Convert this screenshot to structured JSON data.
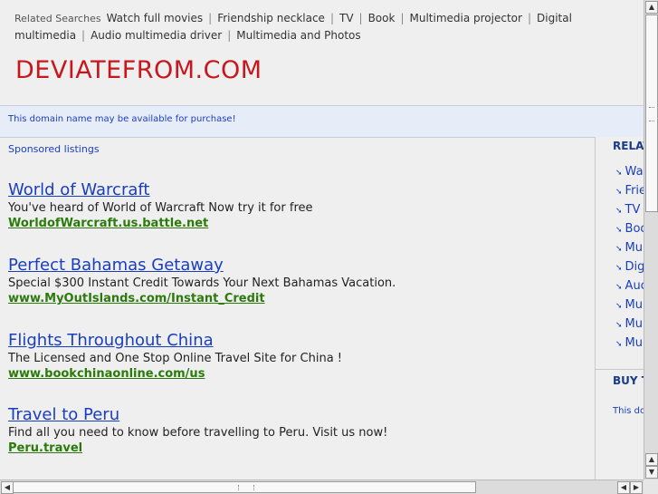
{
  "related_top": {
    "label": "Related Searches",
    "links": [
      "Watch full movies",
      "Friendship necklace",
      "TV",
      "Book",
      "Multimedia projector",
      "Digital multimedia",
      "Audio multimedia driver",
      "Multimedia and Photos"
    ]
  },
  "domain_title": "DEVIATEFROM.COM",
  "availability_notice": "This domain name may be available for purchase!",
  "sponsored_label": "Sponsored listings",
  "ads": [
    {
      "title": "World of Warcraft",
      "description": "You've heard of World of Warcraft Now try it for free",
      "url": "WorldofWarcraft.us.battle.net"
    },
    {
      "title": "Perfect Bahamas Getaway",
      "description": "Special $300 Instant Credit Towards Your Next Bahamas Vacation.",
      "url": "www.MyOutIslands.com/Instant_Credit"
    },
    {
      "title": "Flights Throughout China",
      "description": "The Licensed and One Stop Online Travel Site for China !",
      "url": "www.bookchinaonline.com/us"
    },
    {
      "title": "Travel to Peru",
      "description": "Find all you need to know before travelling to Peru. Visit us now!",
      "url": "Peru.travel"
    }
  ],
  "right_column": {
    "heading": "RELAT",
    "items": [
      "Wa",
      "Frie",
      "TV",
      "Boo",
      "Mul",
      "Dig",
      "Auc",
      "Mul",
      "Mul",
      "Mul"
    ],
    "buy_heading": "BUY T",
    "domain_text": "This dor"
  },
  "icons": {
    "list_bullet": "arrow-bullet-icon",
    "scroll_up": "scroll-up-icon",
    "scroll_down": "scroll-down-icon",
    "scroll_left": "scroll-left-icon",
    "scroll_right": "scroll-right-icon"
  },
  "colors": {
    "domain_title": "#c8161d",
    "link": "#1a3ec0",
    "ad_url": "#2b7a0b",
    "notice_bg": "#e7edf8"
  }
}
